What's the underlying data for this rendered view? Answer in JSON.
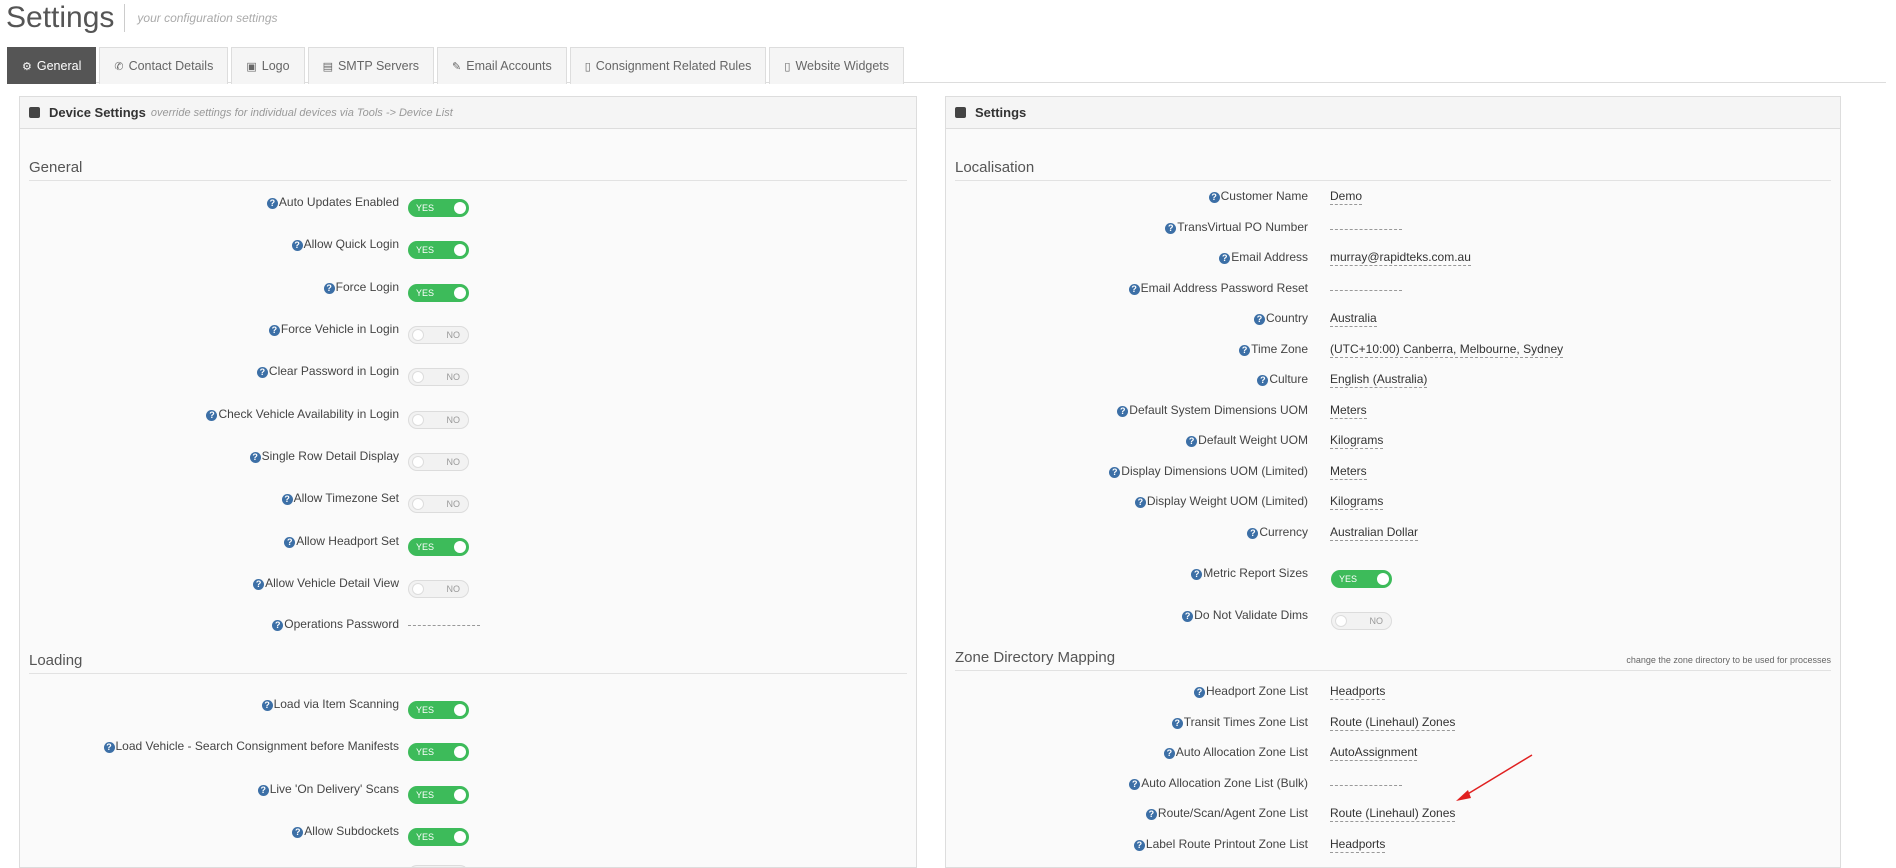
{
  "page": {
    "title": "Settings",
    "subtitle": "your configuration settings"
  },
  "tabs": [
    {
      "label": "General",
      "icon": "gear-icon",
      "glyph": "⚙"
    },
    {
      "label": "Contact Details",
      "icon": "phone-icon",
      "glyph": "✆"
    },
    {
      "label": "Logo",
      "icon": "image-icon",
      "glyph": "▣"
    },
    {
      "label": "SMTP Servers",
      "icon": "server-icon",
      "glyph": "▤"
    },
    {
      "label": "Email Accounts",
      "icon": "paperclip-icon",
      "glyph": "✎"
    },
    {
      "label": "Consignment Related Rules",
      "icon": "file-icon",
      "glyph": "▯"
    },
    {
      "label": "Website Widgets",
      "icon": "file-icon",
      "glyph": "▯"
    }
  ],
  "device_panel": {
    "title": "Device Settings",
    "note": "override settings for individual devices via Tools -> Device List",
    "sections": {
      "general": "General",
      "loading": "Loading"
    },
    "general_items": [
      {
        "label": "Auto Updates Enabled",
        "value": "YES",
        "on": true
      },
      {
        "label": "Allow Quick Login",
        "value": "YES",
        "on": true
      },
      {
        "label": "Force Login",
        "value": "YES",
        "on": true
      },
      {
        "label": "Force Vehicle in Login",
        "value": "NO",
        "on": false
      },
      {
        "label": "Clear Password in Login",
        "value": "NO",
        "on": false
      },
      {
        "label": "Check Vehicle Availability in Login",
        "value": "NO",
        "on": false
      },
      {
        "label": "Single Row Detail Display",
        "value": "NO",
        "on": false
      },
      {
        "label": "Allow Timezone Set",
        "value": "NO",
        "on": false
      },
      {
        "label": "Allow Headport Set",
        "value": "YES",
        "on": true
      },
      {
        "label": "Allow Vehicle Detail View",
        "value": "NO",
        "on": false
      }
    ],
    "operations_password": {
      "label": "Operations Password",
      "value": ""
    },
    "loading_items": [
      {
        "label": "Load via Item Scanning",
        "value": "YES",
        "on": true
      },
      {
        "label": "Load Vehicle - Search Consignment before Manifests",
        "value": "YES",
        "on": true
      },
      {
        "label": "Live 'On Delivery' Scans",
        "value": "YES",
        "on": true
      },
      {
        "label": "Allow Subdockets",
        "value": "YES",
        "on": true
      }
    ]
  },
  "settings_panel": {
    "title": "Settings",
    "sections": {
      "localisation": "Localisation",
      "zone": "Zone Directory Mapping",
      "zone_note": "change the zone directory to be used for processes"
    },
    "localisation_items": [
      {
        "label": "Customer Name",
        "value": "Demo"
      },
      {
        "label": "TransVirtual PO Number",
        "value": ""
      },
      {
        "label": "Email Address",
        "value": "murray@rapidteks.com.au"
      },
      {
        "label": "Email Address Password Reset",
        "value": ""
      },
      {
        "label": "Country",
        "value": "Australia"
      },
      {
        "label": "Time Zone",
        "value": "(UTC+10:00) Canberra, Melbourne, Sydney"
      },
      {
        "label": "Culture",
        "value": "English (Australia)"
      },
      {
        "label": "Default System Dimensions UOM",
        "value": "Meters"
      },
      {
        "label": "Default Weight UOM",
        "value": "Kilograms"
      },
      {
        "label": "Display Dimensions UOM (Limited)",
        "value": "Meters"
      },
      {
        "label": "Display Weight UOM (Limited)",
        "value": "Kilograms"
      },
      {
        "label": "Currency",
        "value": "Australian Dollar"
      }
    ],
    "toggle_items": [
      {
        "label": "Metric Report Sizes",
        "value": "YES",
        "on": true
      },
      {
        "label": "Do Not Validate Dims",
        "value": "NO",
        "on": false
      }
    ],
    "zone_items": [
      {
        "label": "Headport Zone List",
        "value": "Headports"
      },
      {
        "label": "Transit Times Zone List",
        "value": "Route (Linehaul) Zones"
      },
      {
        "label": "Auto Allocation Zone List",
        "value": "AutoAssignment"
      },
      {
        "label": "Auto Allocation Zone List (Bulk)",
        "value": ""
      },
      {
        "label": "Route/Scan/Agent Zone List",
        "value": "Route (Linehaul) Zones"
      },
      {
        "label": "Label Route Printout Zone List",
        "value": "Headports"
      }
    ]
  },
  "colors": {
    "accent": "#3dbb5a",
    "active_tab": "#555555",
    "help_icon": "#3c6fa6",
    "annotation": "#e02020"
  }
}
